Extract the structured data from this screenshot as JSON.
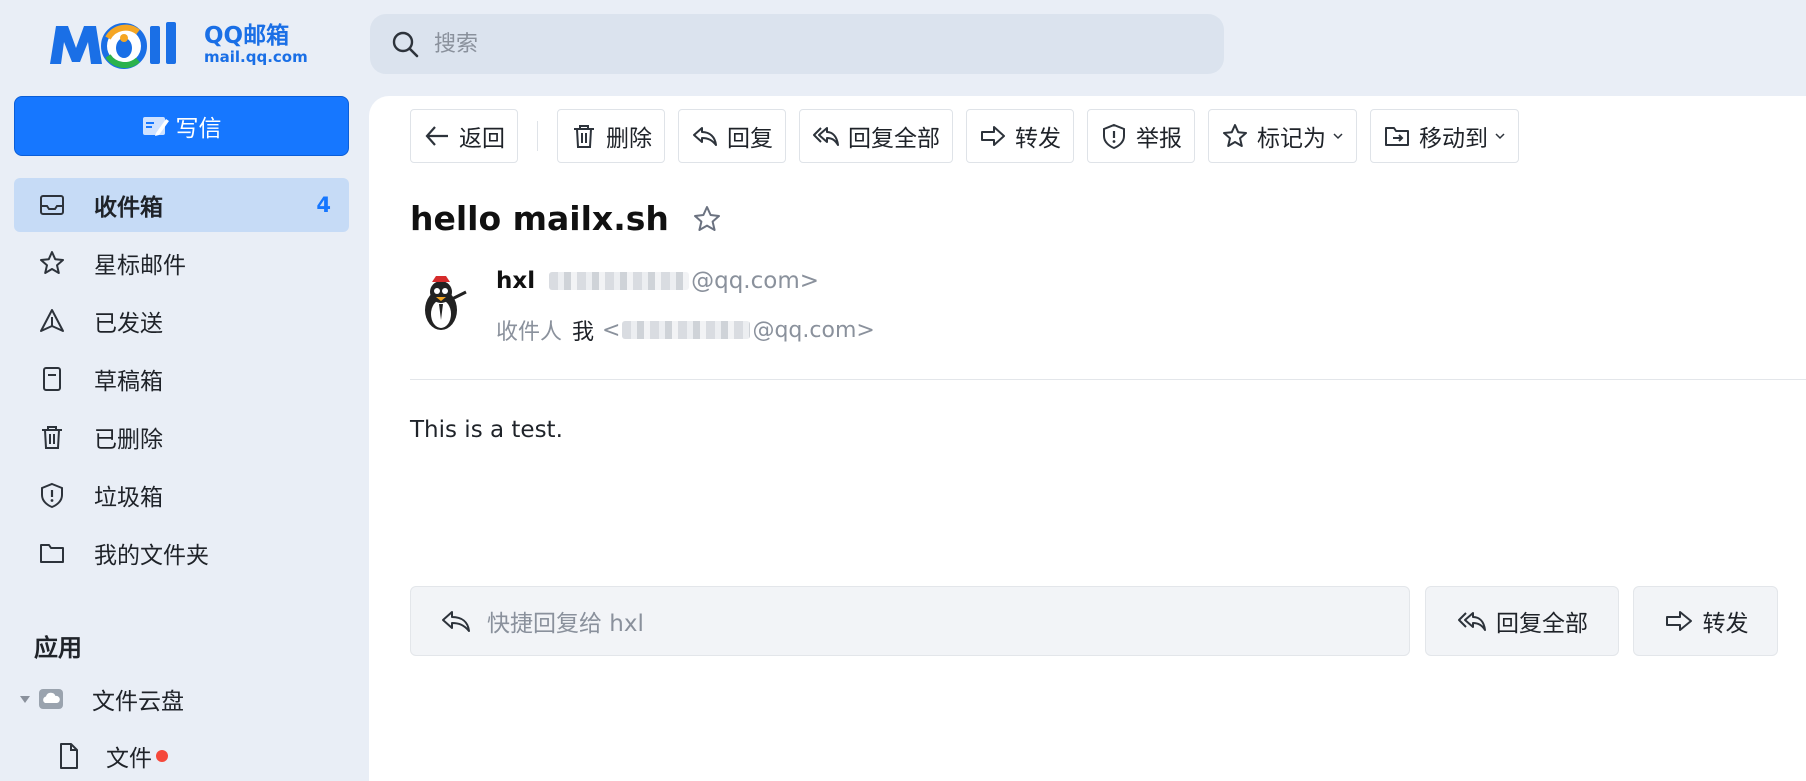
{
  "brand": {
    "title": "QQ邮箱",
    "subtitle": "mail.qq.com",
    "accent": "#1677ff"
  },
  "search": {
    "placeholder": "搜索",
    "icon": "search-icon"
  },
  "sidebar": {
    "compose_label": "写信",
    "items": [
      {
        "label": "收件箱",
        "count": "4",
        "icon": "inbox-icon",
        "active": true
      },
      {
        "label": "星标邮件",
        "icon": "star-icon"
      },
      {
        "label": "已发送",
        "icon": "send-icon"
      },
      {
        "label": "草稿箱",
        "icon": "draft-icon"
      },
      {
        "label": "已删除",
        "icon": "trash-icon"
      },
      {
        "label": "垃圾箱",
        "icon": "shield-icon"
      },
      {
        "label": "我的文件夹",
        "icon": "folder-icon"
      }
    ],
    "apps_title": "应用",
    "cloud_label": "文件云盘",
    "files_label": "文件"
  },
  "toolbar": {
    "back": "返回",
    "delete": "删除",
    "reply": "回复",
    "reply_all": "回复全部",
    "forward": "转发",
    "report": "举报",
    "mark_as": "标记为",
    "move_to": "移动到"
  },
  "mail": {
    "subject": "hello mailx.sh",
    "sender_name": "hxl",
    "sender_addr_suffix": "@qq.com>",
    "recipient_label": "收件人",
    "recipient_name": "我",
    "recipient_addr_prefix": "<",
    "recipient_addr_suffix": "@qq.com>",
    "body": "This is a test."
  },
  "quick_reply": {
    "placeholder": "快捷回复给 hxl",
    "reply_all": "回复全部",
    "forward": "转发"
  }
}
